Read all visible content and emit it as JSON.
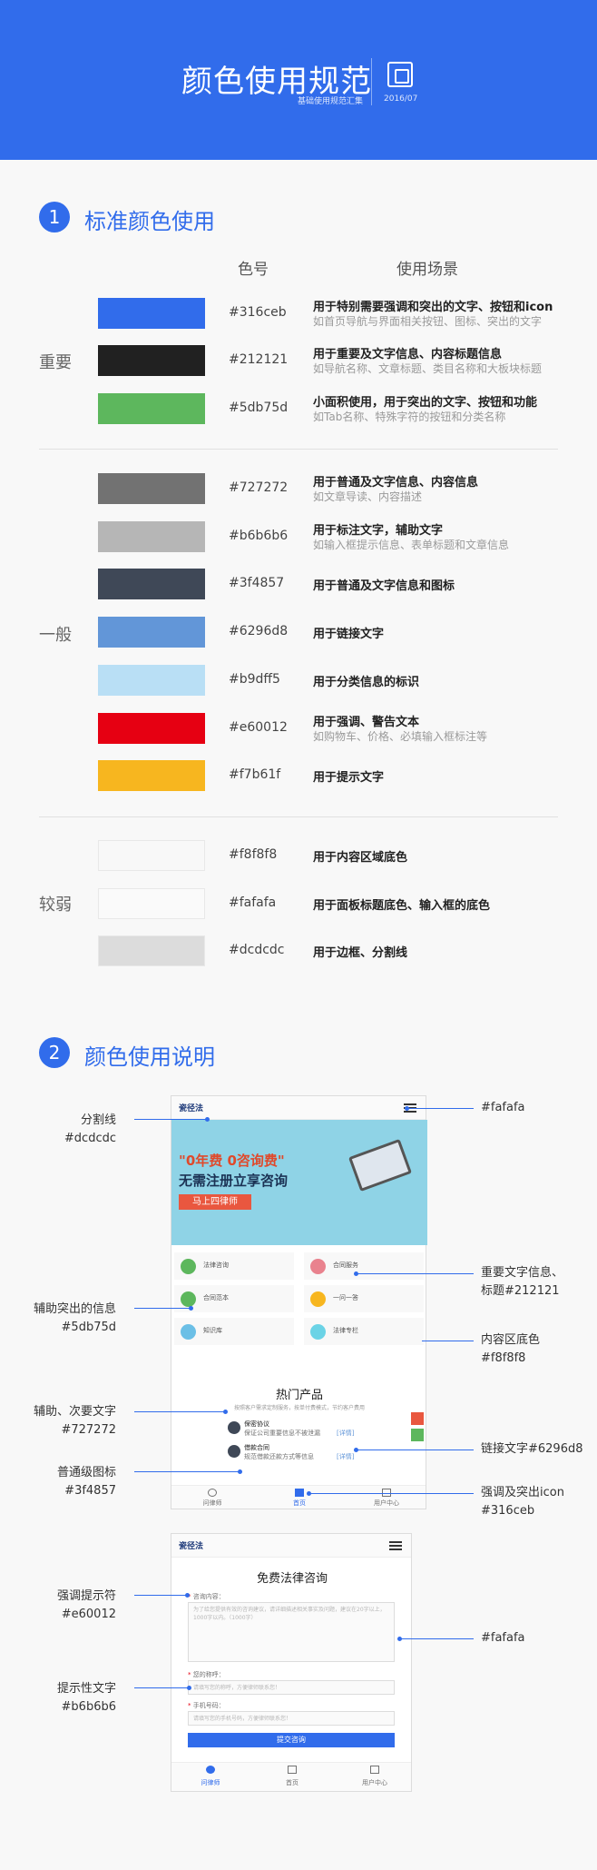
{
  "header": {
    "title": "颜色使用规范",
    "subtitle": "基础使用规范汇集",
    "date": "2016/07",
    "bg": "#316ceb"
  },
  "section1": {
    "num": "1",
    "title": "标准颜色使用",
    "col_code": "色号",
    "col_usage": "使用场景",
    "groups": [
      "重要",
      "一般",
      "较弱"
    ],
    "colors": [
      {
        "hex": "#316ceb",
        "code": "#316ceb",
        "u1": "用于特别需要强调和突出的文字、按钮和icon",
        "u2": "如首页导航与界面相关按钮、图标、突出的文字"
      },
      {
        "hex": "#212121",
        "code": "#212121",
        "u1": "用于重要及文字信息、内容标题信息",
        "u2": "如导航名称、文章标题、类目名称和大板块标题"
      },
      {
        "hex": "#5db75d",
        "code": "#5db75d",
        "u1": "小面积使用，用于突出的文字、按钮和功能",
        "u2": "如Tab名称、特殊字符的按钮和分类名称"
      },
      {
        "hex": "#727272",
        "code": "#727272",
        "u1": "用于普通及文字信息、内容信息",
        "u2": "如文章导读、内容描述"
      },
      {
        "hex": "#b6b6b6",
        "code": "#b6b6b6",
        "u1": "用于标注文字，辅助文字",
        "u2": "如输入框提示信息、表单标题和文章信息"
      },
      {
        "hex": "#3f4857",
        "code": "#3f4857",
        "u1": "用于普通及文字信息和图标",
        "u2": ""
      },
      {
        "hex": "#6296d8",
        "code": "#6296d8",
        "u1": "用于链接文字",
        "u2": ""
      },
      {
        "hex": "#b9dff5",
        "code": "#b9dff5",
        "u1": "用于分类信息的标识",
        "u2": ""
      },
      {
        "hex": "#e60012",
        "code": "#e60012",
        "u1": "用于强调、警告文本",
        "u2": "如购物车、价格、必填输入框标注等"
      },
      {
        "hex": "#f7b61f",
        "code": "#f7b61f",
        "u1": "用于提示文字",
        "u2": ""
      },
      {
        "hex": "#f8f8f8",
        "code": "#f8f8f8",
        "u1": "用于内容区域底色",
        "u2": ""
      },
      {
        "hex": "#fafafa",
        "code": "#fafafa",
        "u1": "用于面板标题底色、输入框的底色",
        "u2": ""
      },
      {
        "hex": "#dcdcdc",
        "code": "#dcdcdc",
        "u1": "用于边框、分割线",
        "u2": ""
      }
    ]
  },
  "section2": {
    "num": "2",
    "title": "颜色使用说明",
    "ann": {
      "divider": [
        "分割线",
        "#dcdcdc"
      ],
      "aux": [
        "辅助突出的信息",
        "#5db75d"
      ],
      "secondary_text": [
        "辅助、次要文字",
        "#727272"
      ],
      "normal_icon": [
        "普通级图标",
        "#3f4857"
      ],
      "panel": [
        "#fafafa"
      ],
      "important": [
        "重要文字信息、",
        "标题#212121"
      ],
      "content_bg": [
        "内容区底色",
        "#f8f8f8"
      ],
      "link": [
        "链接文字#6296d8"
      ],
      "emph": [
        "强调及突出icon",
        "#316ceb"
      ],
      "required": [
        "强调提示符",
        "#e60012"
      ],
      "input_bg": [
        "#fafafa"
      ],
      "hint": [
        "提示性文字",
        "#b6b6b6"
      ]
    },
    "phone1": {
      "logo": "瓷径法",
      "banner_line1": "\"0年费 0咨询费\"",
      "banner_line2": "无需注册立享咨询",
      "banner_btn": "马上四律师",
      "cards": [
        "法律咨询",
        "合同服务",
        "合同范本",
        "一问一答",
        "知识库",
        "法律专栏"
      ],
      "hot_title": "热门产品",
      "hot_sub": "按照客户需求定制服务，按单付费模式，节约客户费用",
      "prod1_title": "保密协议",
      "prod1_desc": "保证公司重要信息不被泄漏",
      "prod2_title": "借款合同",
      "prod2_desc": "规范借款还款方式等信息",
      "link_text": "[详情]",
      "tabs": [
        "问律师",
        "首页",
        "用户中心"
      ]
    },
    "phone2": {
      "logo": "瓷径法",
      "title": "免费法律咨询",
      "q_label": "咨询内容：",
      "q_placeholder": "为了给您提供有效的咨询建议，请详细描述相关事实及问题，建议在20字以上，1000字以内。",
      "q_counter": "（1000字）",
      "name_label": "您的称呼：",
      "name_placeholder": "请填写您的称呼，方便律师联系您！",
      "phone_label": "手机号码：",
      "phone_placeholder": "请填写您的手机号码，方便律师联系您！",
      "required_mark": "*",
      "submit": "提交咨询",
      "tabs": [
        "问律师",
        "首页",
        "用户中心"
      ]
    }
  }
}
